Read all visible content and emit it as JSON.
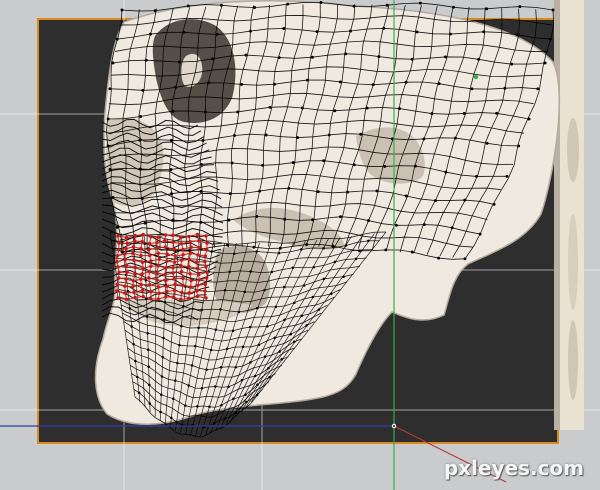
{
  "watermark": {
    "text": "pxleyes.com"
  },
  "scene": {
    "colors": {
      "viewport_bg": "#c9cbcd",
      "canvas_bg": "#2e2e2e",
      "canvas_border": "#d98a1e",
      "grid": "#ffffff",
      "axis_y": "#2fb248",
      "axis_x": "#2e3fa8",
      "axis_diag": "#b23b3b",
      "mesh": "#000000",
      "selected_polys": "#c61b1b",
      "skull": "#efe9df"
    },
    "icons": [
      "skull-model-icon",
      "wireframe-mesh-icon",
      "canvas-backdrop-icon",
      "origin-marker-icon"
    ]
  }
}
